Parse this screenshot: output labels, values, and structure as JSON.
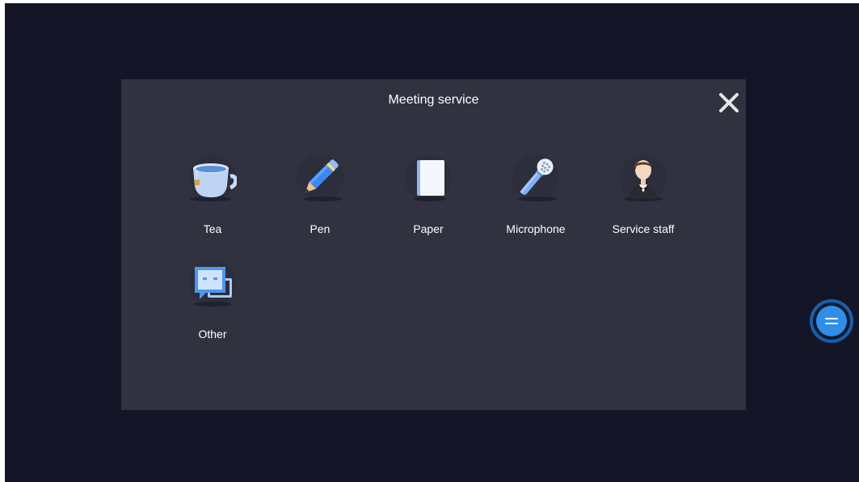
{
  "dialog": {
    "title": "Meeting service",
    "close_icon": "close-icon"
  },
  "services": [
    {
      "label": "Tea",
      "icon": "tea-cup-icon"
    },
    {
      "label": "Pen",
      "icon": "pen-icon"
    },
    {
      "label": "Paper",
      "icon": "paper-icon"
    },
    {
      "label": "Microphone",
      "icon": "microphone-icon"
    },
    {
      "label": "Service staff",
      "icon": "service-staff-icon"
    },
    {
      "label": "Other",
      "icon": "chat-bubbles-icon"
    }
  ],
  "floating_button": {
    "icon": "menu-lines-icon"
  },
  "colors": {
    "background": "#141627",
    "dialog": "#30323f",
    "text": "#ffffff",
    "accent": "#2f8fe8"
  }
}
